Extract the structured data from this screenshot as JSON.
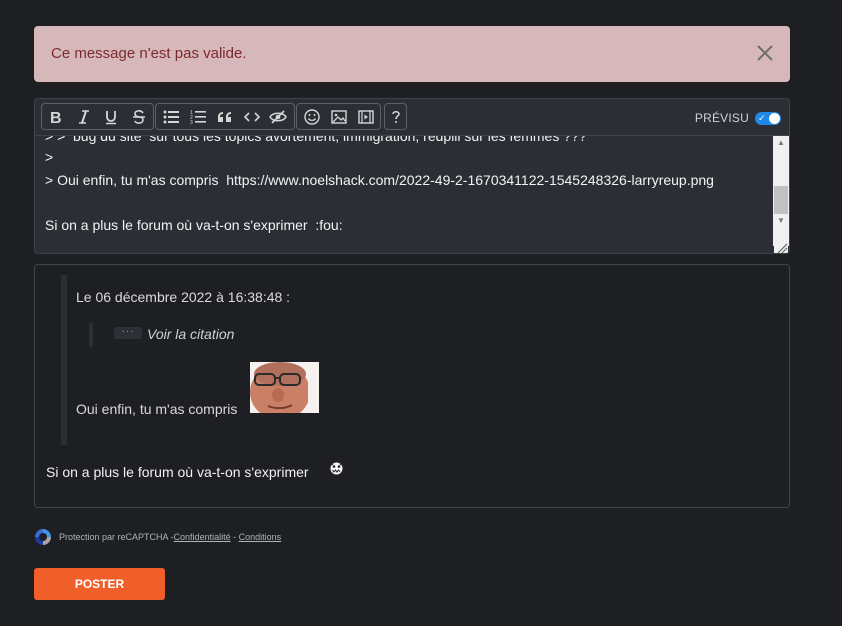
{
  "alert": {
    "message": "Ce message n'est pas valide."
  },
  "toolbar": {
    "groups": [
      [
        "bold-icon",
        "italic-icon",
        "underline-icon",
        "strikethrough-icon"
      ],
      [
        "bullet-list-icon",
        "numbered-list-icon",
        "quote-icon",
        "code-icon",
        "spoiler-icon"
      ],
      [
        "smiley-icon",
        "image-icon",
        "video-icon"
      ],
      [
        "help-icon"
      ]
    ],
    "preview_label": "PRÉVISU",
    "preview_enabled": true
  },
  "textarea": {
    "lines": [
      "> >  bug du site  sur tous les topics avortement, immigration, redpill sur les femmes ???",
      ">",
      "> Oui enfin, tu m'as compris  https://www.noelshack.com/2022-49-2-1670341122-1545248326-larryreup.png",
      "",
      "Si on a plus le forum où va-t-on s'exprimer  :fou:"
    ]
  },
  "preview": {
    "quote_header": "Le 06 décembre 2022 à 16:38:48 :",
    "expand_dots": "···",
    "view_quote": "Voir la citation",
    "quote_text": "Oui enfin, tu m'as compris",
    "final_text": "Si on a plus le forum où va-t-on s'exprimer"
  },
  "captcha": {
    "text": "Protection par reCAPTCHA - ",
    "privacy": "Confidentialité",
    "separator": " - ",
    "terms": "Conditions"
  },
  "submit": {
    "label": "POSTER"
  },
  "colors": {
    "background": "#1d1f23",
    "alert_bg": "#d7b8ba",
    "alert_text": "#7b2a2f",
    "accent": "#f05f2a",
    "toggle": "#1e88e5"
  }
}
